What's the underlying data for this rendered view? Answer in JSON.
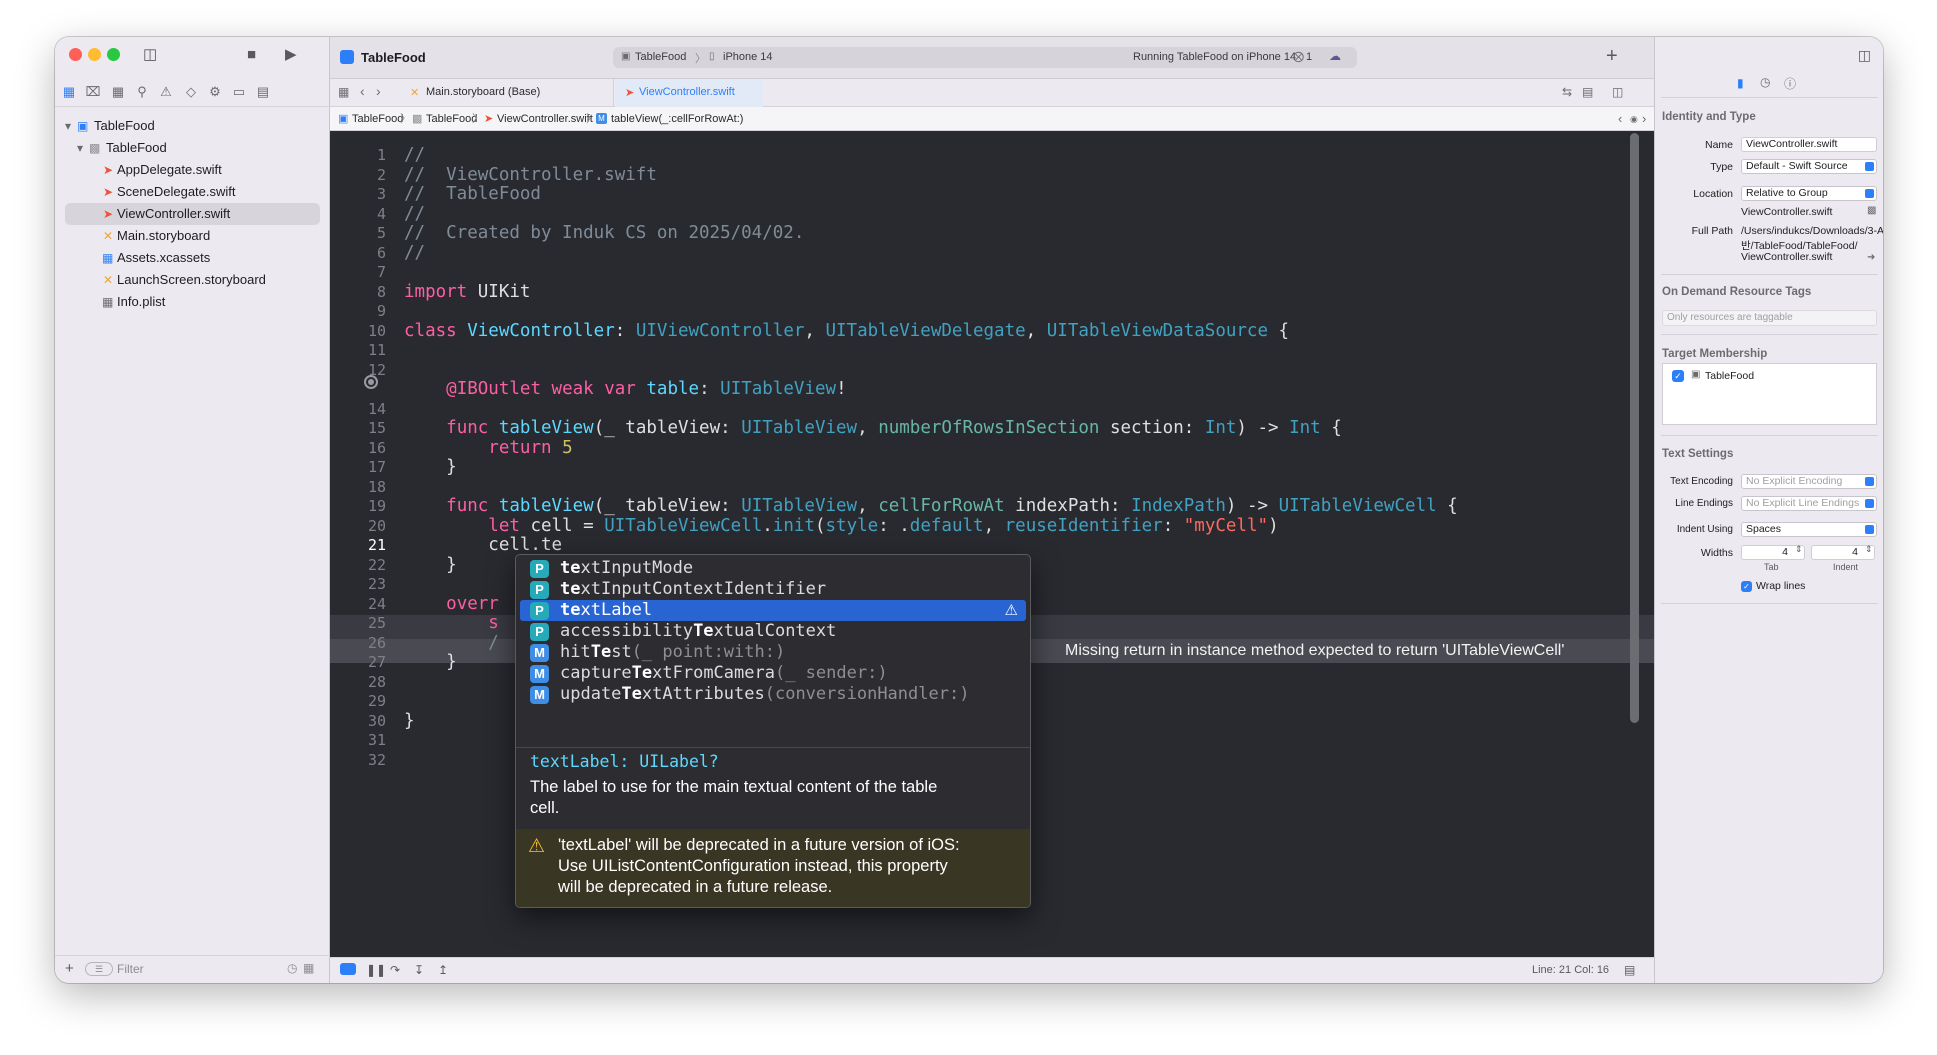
{
  "window": {
    "project_title": "TableFood",
    "scheme": "TableFood",
    "device": "iPhone 14",
    "run_status": "Running TableFood on iPhone 14",
    "issues_count": "1"
  },
  "tabs": [
    {
      "label": "Main.storyboard (Base)"
    },
    {
      "label": "ViewController.swift"
    }
  ],
  "jumpbar": [
    "TableFood",
    "TableFood",
    "ViewController.swift",
    "tableView(_:cellForRowAt:)"
  ],
  "navigator": {
    "items": [
      {
        "label": "TableFood",
        "icon": "app-project-icon"
      },
      {
        "label": "TableFood",
        "icon": "folder-icon"
      },
      {
        "label": "AppDelegate.swift",
        "icon": "swift-file-icon"
      },
      {
        "label": "SceneDelegate.swift",
        "icon": "swift-file-icon"
      },
      {
        "label": "ViewController.swift",
        "icon": "swift-file-icon"
      },
      {
        "label": "Main.storyboard",
        "icon": "storyboard-icon"
      },
      {
        "label": "Assets.xcassets",
        "icon": "assets-icon"
      },
      {
        "label": "LaunchScreen.storyboard",
        "icon": "storyboard-icon"
      },
      {
        "label": "Info.plist",
        "icon": "plist-icon"
      }
    ],
    "filter_placeholder": "Filter"
  },
  "editor": {
    "line_numbers": [
      "1",
      "2",
      "3",
      "4",
      "5",
      "6",
      "7",
      "8",
      "9",
      "10",
      "11",
      "12",
      "",
      "14",
      "15",
      "16",
      "17",
      "18",
      "19",
      "20",
      "21",
      "22",
      "23",
      "24",
      "25",
      "26",
      "27",
      "28",
      "29",
      "30",
      "31",
      "32"
    ],
    "current_line": "21",
    "error_message": "Missing return in instance method expected to return 'UITableViewCell'"
  },
  "completion": {
    "items": [
      {
        "kind": "P",
        "pre": "",
        "match": "te",
        "post": "xtInputMode",
        "args": ""
      },
      {
        "kind": "P",
        "pre": "",
        "match": "te",
        "post": "xtInputContextIdentifier",
        "args": ""
      },
      {
        "kind": "P",
        "pre": "",
        "match": "te",
        "post": "xtLabel",
        "args": ""
      },
      {
        "kind": "P",
        "pre": "accessibility",
        "match": "Te",
        "post": "xtualContext",
        "args": ""
      },
      {
        "kind": "M",
        "pre": "hit",
        "match": "Te",
        "post": "st",
        "args": "(_ point:with:)"
      },
      {
        "kind": "M",
        "pre": "capture",
        "match": "Te",
        "post": "xtFromCamera",
        "args": "(_ sender:)"
      },
      {
        "kind": "M",
        "pre": "update",
        "match": "Te",
        "post": "xtAttributes",
        "args": "(conversionHandler:)"
      }
    ],
    "doc_signature_name": "textLabel",
    "doc_signature_type": ": UILabel?",
    "doc_line1": "The label to use for the main textual content of the table",
    "doc_line2": "cell.",
    "warn_line1": "'textLabel' will be deprecated in a future version of iOS:",
    "warn_line2": "Use UIListContentConfiguration instead, this property",
    "warn_line3": "will be deprecated in a future release."
  },
  "status_bar": {
    "position": "Line: 21  Col: 16"
  },
  "inspector": {
    "identity_title": "Identity and Type",
    "name_label": "Name",
    "name_value": "ViewController.swift",
    "type_label": "Type",
    "type_value": "Default - Swift Source",
    "location_label": "Location",
    "location_value": "Relative to Group",
    "location_file": "ViewController.swift",
    "fullpath_label": "Full Path",
    "fullpath_1": "/Users/indukcs/Downloads/3-A",
    "fullpath_2": "반/TableFood/TableFood/",
    "fullpath_3": "ViewController.swift",
    "odr_title": "On Demand Resource Tags",
    "odr_placeholder": "Only resources are taggable",
    "target_title": "Target Membership",
    "target_item": "TableFood",
    "text_title": "Text Settings",
    "encoding_label": "Text Encoding",
    "encoding_value": "No Explicit Encoding",
    "endings_label": "Line Endings",
    "endings_value": "No Explicit Line Endings",
    "indent_label": "Indent Using",
    "indent_value": "Spaces",
    "widths_label": "Widths",
    "tab_value": "4",
    "indent_width_value": "4",
    "tab_caption": "Tab",
    "indent_caption": "Indent",
    "wrap_label": "Wrap lines"
  }
}
